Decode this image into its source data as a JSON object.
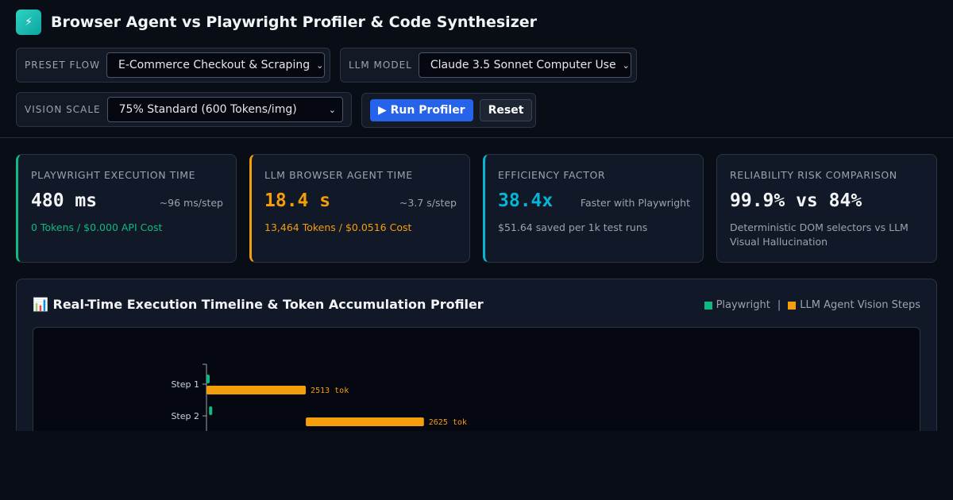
{
  "header": {
    "logo_icon": "⚡",
    "title": "Browser Agent vs Playwright Profiler & Code Synthesizer"
  },
  "controls": {
    "preset_label": "PRESET FLOW",
    "preset_value": "E-Commerce Checkout & Scraping",
    "model_label": "LLM MODEL",
    "model_value": "Claude 3.5 Sonnet Computer Use",
    "scale_label": "VISION SCALE",
    "scale_value": "75% Standard (600 Tokens/img)",
    "run_label": "▶ Run Profiler",
    "reset_label": "Reset"
  },
  "cards": [
    {
      "title": "PLAYWRIGHT EXECUTION TIME",
      "value": "480 ms",
      "side": "~96 ms/step",
      "sub": "0 Tokens / $0.000 API Cost"
    },
    {
      "title": "LLM BROWSER AGENT TIME",
      "value": "18.4 s",
      "side": "~3.7 s/step",
      "sub": "13,464 Tokens / $0.0516 Cost"
    },
    {
      "title": "EFFICIENCY FACTOR",
      "value": "38.4x",
      "side": "Faster with Playwright",
      "sub": "$51.64 saved per 1k test runs"
    },
    {
      "title": "RELIABILITY RISK COMPARISON",
      "value": "99.9% vs 84%",
      "side": "",
      "sub": "Deterministic DOM selectors vs LLM Visual Hallucination"
    }
  ],
  "timeline": {
    "icon": "📊",
    "title": "Real-Time Execution Timeline & Token Accumulation Profiler",
    "legend_playwright": "Playwright",
    "legend_separator": "|",
    "legend_agent": "LLM Agent Vision Steps",
    "colors": {
      "playwright": "#10b981",
      "agent": "#f59e0b"
    }
  },
  "chart_data": {
    "type": "bar",
    "categories": [
      "Step 1",
      "Step 2"
    ],
    "series": [
      {
        "name": "Playwright",
        "start": [
          0,
          96
        ],
        "duration": [
          96,
          96
        ]
      },
      {
        "name": "LLM Agent Vision Steps",
        "start": [
          0,
          3700
        ],
        "duration": [
          3700,
          4400
        ],
        "labels": [
          "2513 tok",
          "2625 tok"
        ]
      }
    ]
  }
}
